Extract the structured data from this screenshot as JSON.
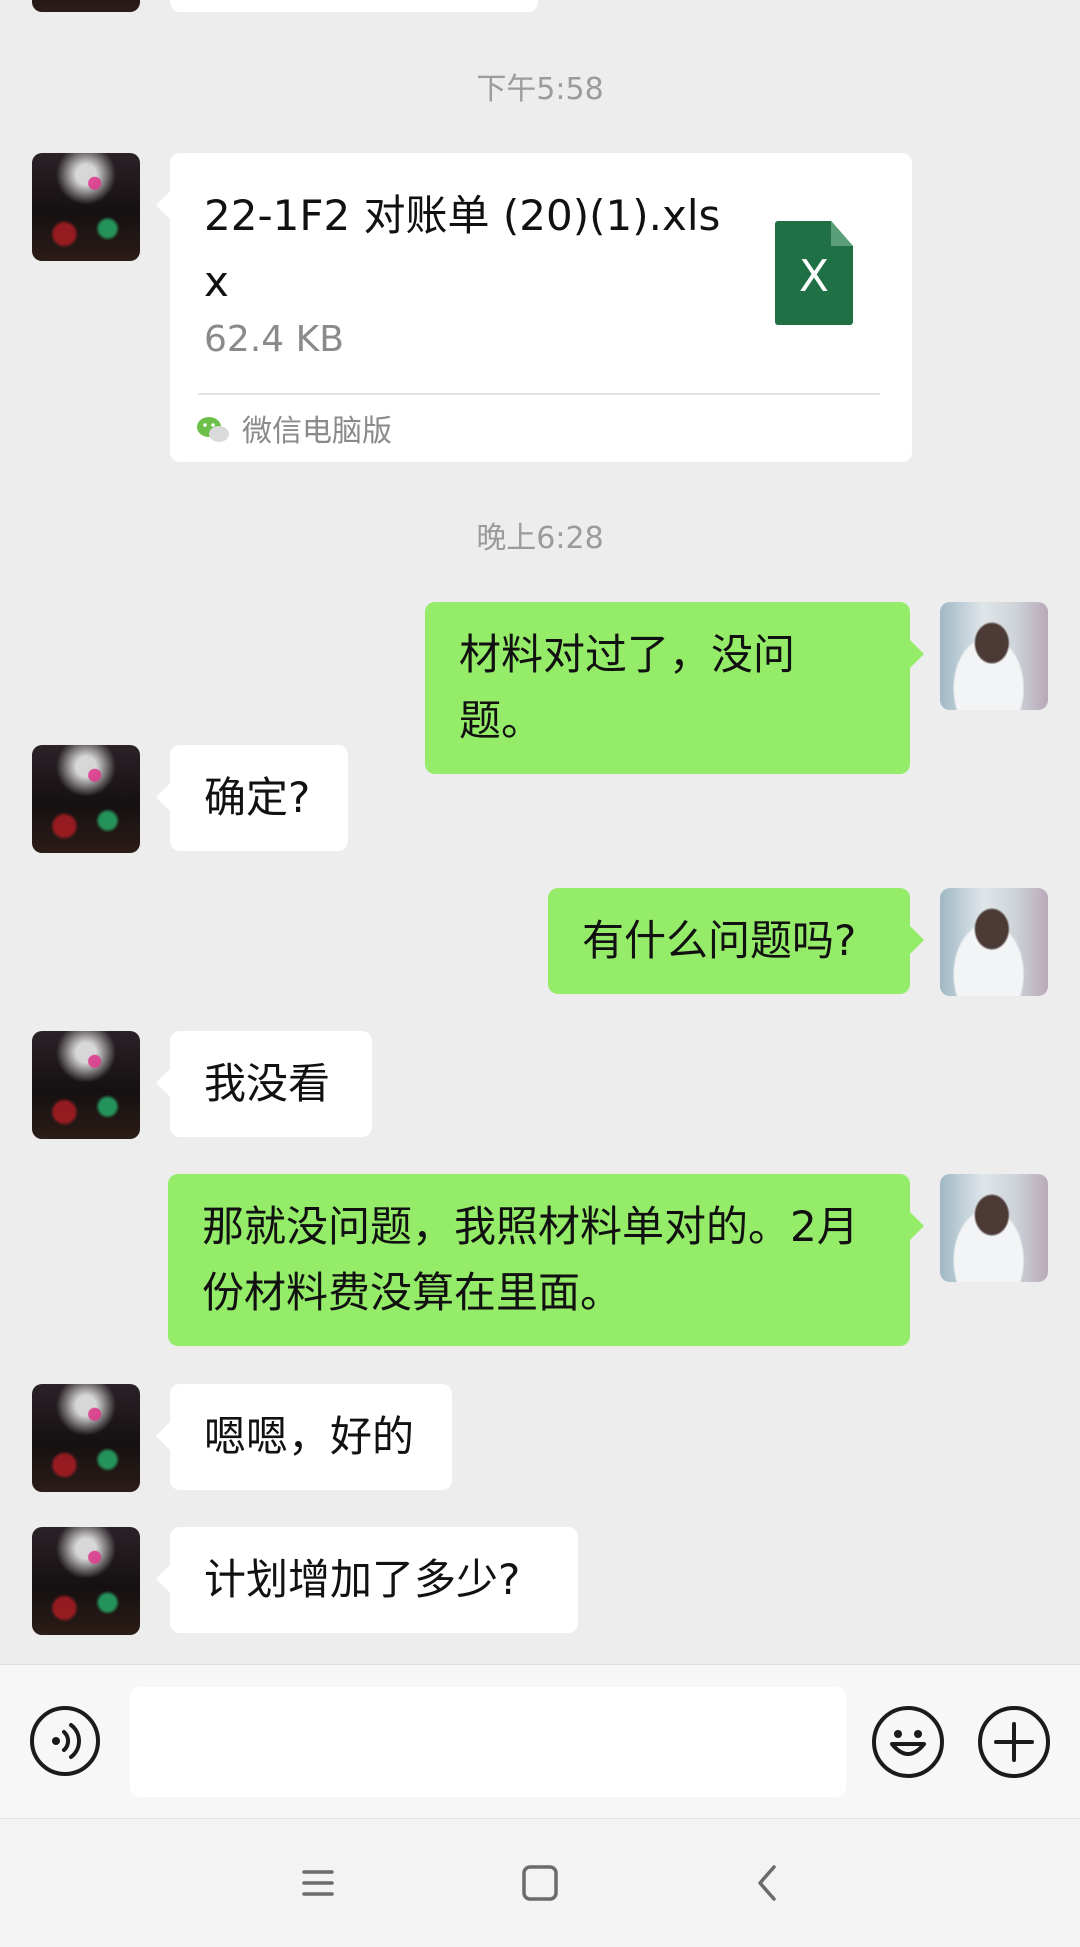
{
  "timestamps": [
    "下午5:58",
    "晚上6:28"
  ],
  "file_message": {
    "name": "22-1F2 对账单 (20)(1).xlsx",
    "size": "62.4 KB",
    "icon": "excel-file-icon",
    "icon_letter": "X",
    "source": "微信电脑版"
  },
  "messages": [
    {
      "from": "me",
      "text": "材料对过了，没问题。"
    },
    {
      "from": "them",
      "text": "确定?"
    },
    {
      "from": "me",
      "text": "有什么问题吗?"
    },
    {
      "from": "them",
      "text": "我没看"
    },
    {
      "from": "me",
      "text": "那就没问题，我照材料单对的。2月份材料费没算在里面。"
    },
    {
      "from": "them",
      "text": "嗯嗯，好的"
    },
    {
      "from": "them",
      "text": "计划增加了多少?"
    }
  ],
  "input_bar": {
    "voice_icon": "voice-icon",
    "emoji_icon": "emoji-icon",
    "plus_icon": "plus-icon",
    "text_value": ""
  },
  "nav": {
    "menu_icon": "menu-icon",
    "home_icon": "home-icon",
    "back_icon": "back-icon"
  },
  "colors": {
    "background": "#ededed",
    "my_bubble": "#95ec69",
    "their_bubble": "#ffffff",
    "excel_green": "#1f7145"
  }
}
